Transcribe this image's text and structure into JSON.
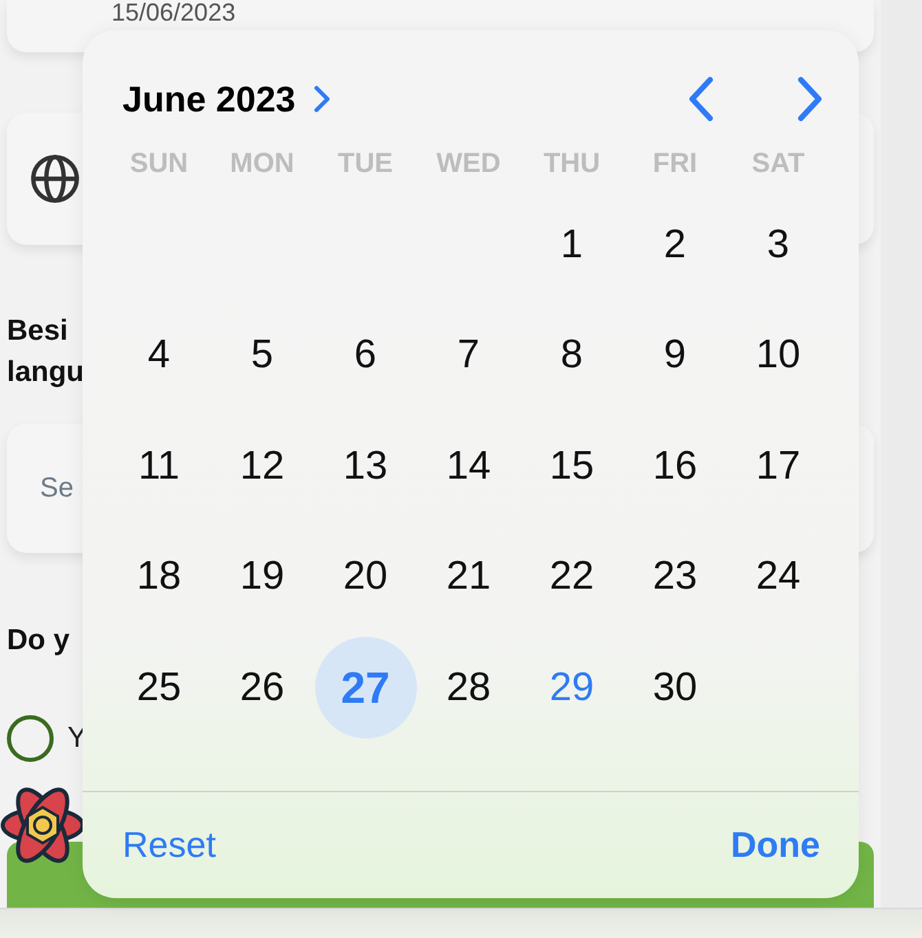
{
  "form": {
    "date_field": {
      "value": "15/06/2023"
    },
    "question_1": "Besi\nlangu",
    "language_search": {
      "placeholder": "Se"
    },
    "question_2": "Do y",
    "options": [
      {
        "label": "Y",
        "selected": false
      }
    ]
  },
  "date_picker": {
    "month_label": "June 2023",
    "weekdays": [
      "SUN",
      "MON",
      "TUE",
      "WED",
      "THU",
      "FRI",
      "SAT"
    ],
    "weeks": [
      {
        "days": [
          {
            "kind": "empty"
          },
          {
            "kind": "empty"
          },
          {
            "kind": "empty"
          },
          {
            "kind": "empty"
          },
          {
            "kind": "day",
            "label": "1",
            "selected": false,
            "today": false
          },
          {
            "kind": "day",
            "label": "2",
            "selected": false,
            "today": false
          },
          {
            "kind": "day",
            "label": "3",
            "selected": false,
            "today": false
          }
        ]
      },
      {
        "days": [
          {
            "kind": "day",
            "label": "4",
            "selected": false,
            "today": false
          },
          {
            "kind": "day",
            "label": "5",
            "selected": false,
            "today": false
          },
          {
            "kind": "day",
            "label": "6",
            "selected": false,
            "today": false
          },
          {
            "kind": "day",
            "label": "7",
            "selected": false,
            "today": false
          },
          {
            "kind": "day",
            "label": "8",
            "selected": false,
            "today": false
          },
          {
            "kind": "day",
            "label": "9",
            "selected": false,
            "today": false
          },
          {
            "kind": "day",
            "label": "10",
            "selected": false,
            "today": false
          }
        ]
      },
      {
        "days": [
          {
            "kind": "day",
            "label": "11",
            "selected": false,
            "today": false
          },
          {
            "kind": "day",
            "label": "12",
            "selected": false,
            "today": false
          },
          {
            "kind": "day",
            "label": "13",
            "selected": false,
            "today": false
          },
          {
            "kind": "day",
            "label": "14",
            "selected": false,
            "today": false
          },
          {
            "kind": "day",
            "label": "15",
            "selected": false,
            "today": false
          },
          {
            "kind": "day",
            "label": "16",
            "selected": false,
            "today": false
          },
          {
            "kind": "day",
            "label": "17",
            "selected": false,
            "today": false
          }
        ]
      },
      {
        "days": [
          {
            "kind": "day",
            "label": "18",
            "selected": false,
            "today": false
          },
          {
            "kind": "day",
            "label": "19",
            "selected": false,
            "today": false
          },
          {
            "kind": "day",
            "label": "20",
            "selected": false,
            "today": false
          },
          {
            "kind": "day",
            "label": "21",
            "selected": false,
            "today": false
          },
          {
            "kind": "day",
            "label": "22",
            "selected": false,
            "today": false
          },
          {
            "kind": "day",
            "label": "23",
            "selected": false,
            "today": false
          },
          {
            "kind": "day",
            "label": "24",
            "selected": false,
            "today": false
          }
        ]
      },
      {
        "days": [
          {
            "kind": "day",
            "label": "25",
            "selected": false,
            "today": false
          },
          {
            "kind": "day",
            "label": "26",
            "selected": false,
            "today": false
          },
          {
            "kind": "day",
            "label": "27",
            "selected": true,
            "today": false
          },
          {
            "kind": "day",
            "label": "28",
            "selected": false,
            "today": false
          },
          {
            "kind": "day",
            "label": "29",
            "selected": false,
            "today": true
          },
          {
            "kind": "day",
            "label": "30",
            "selected": false,
            "today": false
          }
        ]
      }
    ],
    "buttons": {
      "reset": "Reset",
      "done": "Done"
    }
  }
}
